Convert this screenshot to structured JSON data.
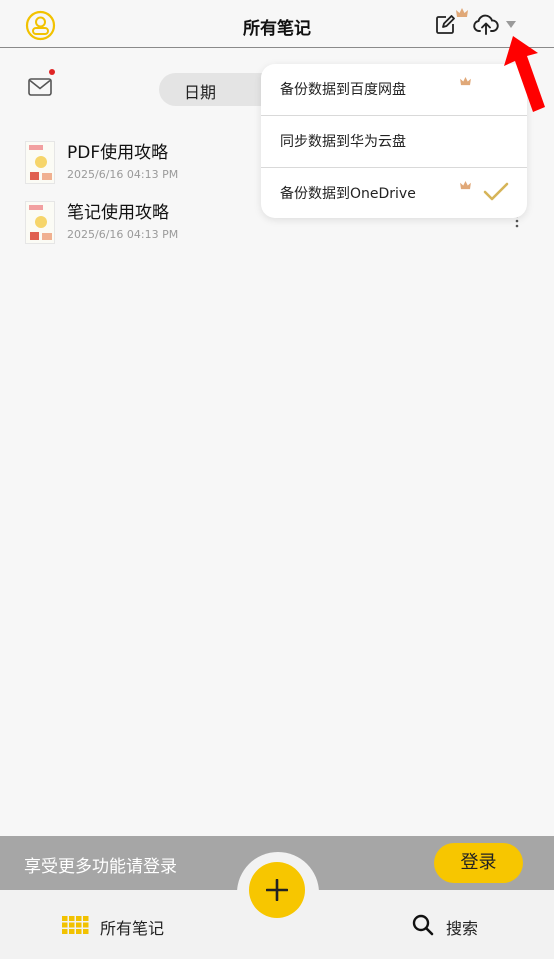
{
  "header": {
    "title": "所有笔记"
  },
  "toolbar": {
    "date_tab": "日期"
  },
  "notes": [
    {
      "title": "PDF使用攻略",
      "date": "2025/6/16 04:13 PM"
    },
    {
      "title": "笔记使用攻略",
      "date": "2025/6/16 04:13 PM"
    }
  ],
  "backup_menu": {
    "items": [
      {
        "label": "备份数据到百度网盘",
        "premium": true,
        "selected": false
      },
      {
        "label": "同步数据到华为云盘",
        "premium": false,
        "selected": false
      },
      {
        "label": "备份数据到OneDrive",
        "premium": true,
        "selected": true
      }
    ]
  },
  "login_bar": {
    "text": "享受更多功能请登录",
    "button": "登录"
  },
  "bottom_nav": {
    "all_notes": "所有笔记",
    "search": "搜索"
  },
  "colors": {
    "accent": "#f7c600",
    "crown": "#e0a878",
    "check": "#d6b458",
    "arrow": "#ff0000",
    "badge": "#e02525"
  },
  "icons": [
    "user-icon",
    "edit-icon",
    "crown-icon",
    "cloud-upload-icon",
    "dropdown-icon",
    "mail-icon",
    "more-icon",
    "check-icon",
    "plus-icon",
    "grid-icon",
    "search-icon"
  ]
}
